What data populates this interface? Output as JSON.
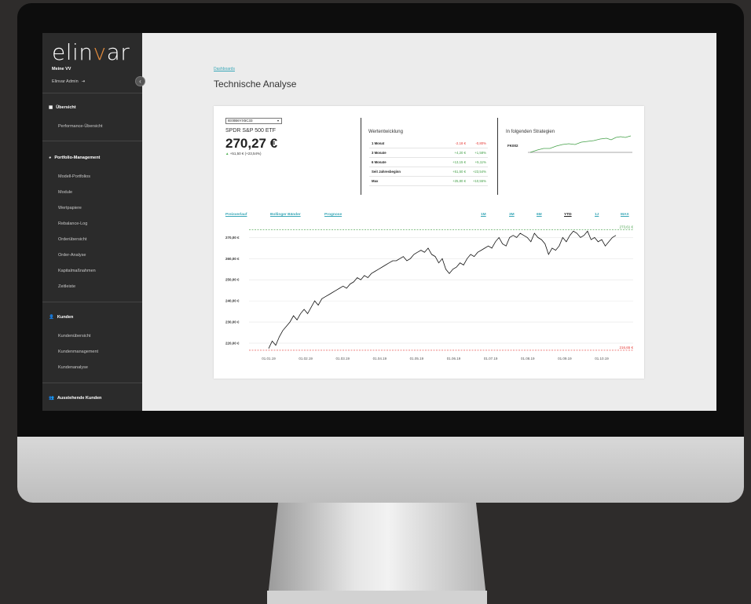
{
  "sidebar": {
    "logo_prefix": "elin",
    "logo_v": "v",
    "logo_suffix": "ar",
    "account": "Meine VV",
    "user": "Elinvar Admin",
    "sections": [
      {
        "title": "Übersicht",
        "items": [
          "Performance-Übersicht"
        ]
      },
      {
        "title": "Portfolio-Management",
        "items": [
          "Modell-Portfolios",
          "Module",
          "Wertpapiere",
          "Rebalance-Log",
          "Orderübersicht",
          "Order-Analyse",
          "Kapitalmaßnahmen",
          "Zeitleiste"
        ]
      },
      {
        "title": "Kunden",
        "items": [
          "Kundenübersicht",
          "Kundenmanagement",
          "Kundenanalyse"
        ]
      },
      {
        "title": "Ausstehende Kunden",
        "items": []
      }
    ]
  },
  "header": {
    "breadcrumb": "Dashboards",
    "title": "Technische Analyse"
  },
  "security": {
    "isin": "IE00B6YX5C33",
    "name": "SPDR S&P 500 ETF",
    "price": "270,27 €",
    "change": "+51,50 € (+23,54%)"
  },
  "performance": {
    "title": "Wertentwicklung",
    "rows": [
      {
        "label": "1 Monat",
        "abs": "-2,18 €",
        "pct": "-0,80%",
        "dir": "neg"
      },
      {
        "label": "3 Monate",
        "abs": "+4,20 €",
        "pct": "+1,58%",
        "dir": "pos"
      },
      {
        "label": "6 Monate",
        "abs": "+13,15 €",
        "pct": "+5,11%",
        "dir": "pos"
      },
      {
        "label": "Seit Jahresbeginn",
        "abs": "+51,50 €",
        "pct": "+23,54%",
        "dir": "pos"
      },
      {
        "label": "Max",
        "abs": "+25,80 €",
        "pct": "+10,55%",
        "dir": "pos"
      }
    ]
  },
  "strategies": {
    "title": "In folgenden Strategien",
    "items": [
      "FK002"
    ]
  },
  "chart_tabs": {
    "left": [
      "Preisverlauf",
      "Bollinger Bänder",
      "Prognose"
    ],
    "ranges": [
      "1M",
      "3M",
      "6M",
      "YTD",
      "1J",
      "MAX"
    ],
    "active_range": "YTD"
  },
  "colors": {
    "accent": "#3aa8b8",
    "high_line": "#43a047",
    "low_line": "#e53935",
    "sidebar_bg": "#2b2b2b"
  },
  "chart_data": {
    "type": "line",
    "ylabels": [
      "270,00 €",
      "260,00 €",
      "250,00 €",
      "240,00 €",
      "230,00 €",
      "220,00 €"
    ],
    "yticks": [
      270,
      260,
      250,
      240,
      230,
      220
    ],
    "ylim": [
      217,
      273.5
    ],
    "xlabels": [
      "01.01.19",
      "01.02.19",
      "01.03.19",
      "01.04.19",
      "01.05.19",
      "01.06.19",
      "01.07.19",
      "01.08.19",
      "01.09.19",
      "01.10.19"
    ],
    "high_label": "273,61 €",
    "high_value": 273.61,
    "low_label": "216,65 €",
    "low_value": 216.65,
    "series": [
      {
        "values": [
          217.5,
          221,
          219,
          223,
          226,
          228,
          230,
          233,
          231,
          234,
          236,
          234,
          237,
          240,
          238,
          241,
          242,
          243,
          244,
          245,
          246,
          247,
          246,
          248,
          249,
          251,
          250,
          252,
          251,
          253,
          254,
          255,
          256,
          257,
          258,
          259,
          259,
          260,
          261,
          259,
          260,
          262,
          263,
          264,
          263,
          265,
          262,
          261,
          258,
          260,
          255,
          253,
          255,
          256,
          258,
          257,
          260,
          262,
          261,
          263,
          264,
          265,
          266,
          265,
          268,
          270,
          267,
          266,
          270,
          271,
          270,
          272,
          271,
          270,
          268,
          272,
          270,
          269,
          267,
          262,
          265,
          264,
          266,
          270,
          268,
          271,
          273,
          272,
          270,
          271,
          273,
          269,
          270,
          268,
          269,
          266,
          268,
          270,
          271
        ]
      }
    ]
  }
}
